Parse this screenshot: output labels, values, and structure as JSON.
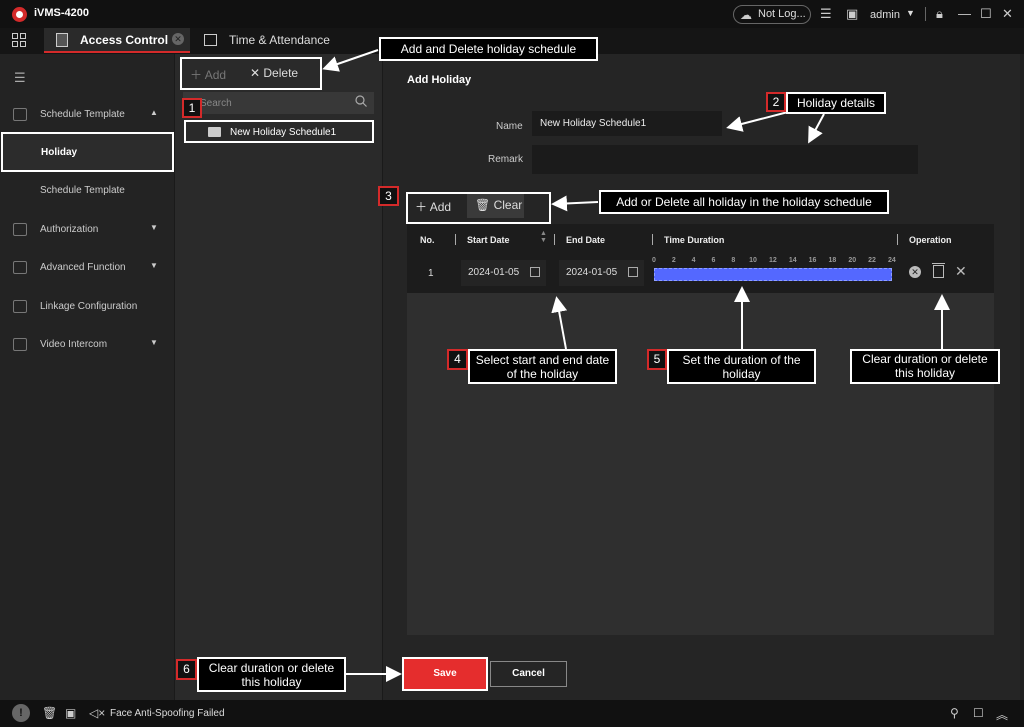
{
  "window": {
    "app_name": "iVMS-4200",
    "cloud_status": "Not Log...",
    "user": "admin"
  },
  "tabs": [
    {
      "label": "Access Control"
    },
    {
      "label": "Time & Attendance"
    }
  ],
  "sidebar": {
    "items": [
      {
        "label": "Schedule Template"
      },
      {
        "label": "Holiday"
      },
      {
        "label": "Schedule Template"
      },
      {
        "label": "Authorization"
      },
      {
        "label": "Advanced Function"
      },
      {
        "label": "Linkage Configuration"
      },
      {
        "label": "Video Intercom"
      }
    ]
  },
  "list": {
    "add_label": "Add",
    "delete_label": "Delete",
    "search_placeholder": "Search",
    "items": [
      {
        "label": "New Holiday Schedule1"
      }
    ]
  },
  "form": {
    "title": "Add Holiday",
    "name_label": "Name",
    "name_value": "New Holiday Schedule1",
    "remark_label": "Remark",
    "remark_value": ""
  },
  "table": {
    "add_label": "Add",
    "clear_label": "Clear",
    "headers": {
      "no": "No.",
      "start": "Start Date",
      "end": "End Date",
      "duration": "Time Duration",
      "operation": "Operation"
    },
    "hour_ticks": [
      "0",
      "2",
      "4",
      "6",
      "8",
      "10",
      "12",
      "14",
      "16",
      "18",
      "20",
      "22",
      "24"
    ],
    "rows": [
      {
        "no": "1",
        "start_date": "2024-01-05",
        "end_date": "2024-01-05",
        "duration_start_hour": 0,
        "duration_end_hour": 24
      }
    ]
  },
  "buttons": {
    "save": "Save",
    "cancel": "Cancel"
  },
  "status": {
    "text": "Face Anti-Spoofing Failed"
  },
  "callouts": {
    "c0": "Add and Delete holiday schedule",
    "c2": "Holiday details",
    "c3": "Add or Delete all holiday in the holiday schedule",
    "c4": "Select start and end date of the holiday",
    "c5": "Set the duration of the holiday",
    "c_op": "Clear duration or delete this holiday",
    "c6": "Clear duration or delete this holiday"
  },
  "badges": {
    "b1": "1",
    "b2": "2",
    "b3": "3",
    "b4": "4",
    "b5": "5",
    "b6": "6"
  },
  "colors": {
    "accent": "#d42a2a",
    "save": "#e52d2d",
    "duration_bar": "#5468ff",
    "callout_bg": "#000000"
  }
}
